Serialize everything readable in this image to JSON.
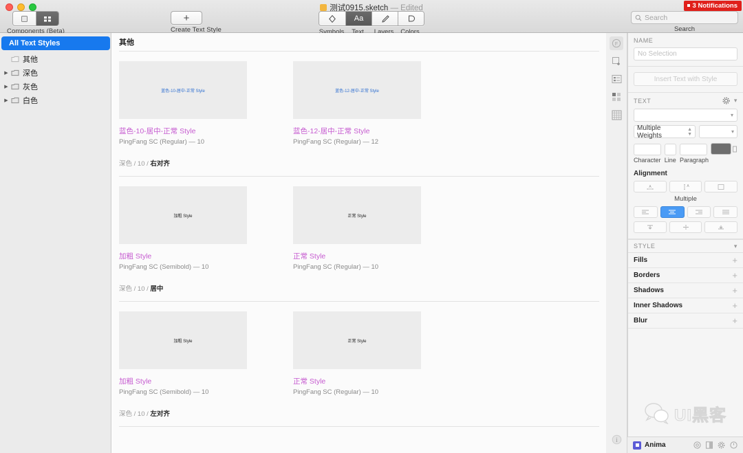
{
  "window": {
    "document_title": "测试0915.sketch",
    "document_state": "— Edited"
  },
  "toolbar": {
    "components_label": "Components (Beta)",
    "create_text_style_label": "Create Text Style",
    "create_text_style_glyph": "+",
    "view_buttons": [
      {
        "label": "Symbols",
        "icon": "diamond-icon",
        "active": false
      },
      {
        "label": "Text",
        "icon": "text-aa-icon",
        "active": true
      },
      {
        "label": "Layers",
        "icon": "layers-brush-icon",
        "active": false
      },
      {
        "label": "Colors",
        "icon": "colors-palette-icon",
        "active": false
      }
    ],
    "text_glyph": "Aa",
    "notifications": "3 Notifications",
    "search_placeholder": "Search",
    "search_label": "Search",
    "search_value": ""
  },
  "sidebar": {
    "items": [
      {
        "label": "All Text Styles",
        "selected": true,
        "has_disclosure": false,
        "icon": "none"
      },
      {
        "label": "其他",
        "selected": false,
        "has_disclosure": false,
        "icon": "folder-icon"
      },
      {
        "label": "深色",
        "selected": false,
        "has_disclosure": true,
        "icon": "folder-icon"
      },
      {
        "label": "灰色",
        "selected": false,
        "has_disclosure": true,
        "icon": "folder-icon"
      },
      {
        "label": "白色",
        "selected": false,
        "has_disclosure": true,
        "icon": "folder-icon"
      }
    ]
  },
  "canvas": {
    "group_title": "其他",
    "rows": [
      {
        "breadcrumb_prefix": "深色 / 10 / ",
        "breadcrumb_bold": "右对齐",
        "cards": [
          {
            "preview_text": "蓝色-10-居中-正常 Style",
            "preview_color": "blue",
            "name": "蓝色-10-居中-正常 Style",
            "meta": "PingFang SC (Regular) — 10"
          },
          {
            "preview_text": "蓝色-12-居中-正常 Style",
            "preview_color": "blue",
            "name": "蓝色-12-居中-正常 Style",
            "meta": "PingFang SC (Regular) — 12"
          }
        ]
      },
      {
        "breadcrumb_prefix": "深色 / 10 / ",
        "breadcrumb_bold": "居中",
        "cards": [
          {
            "preview_text": "加粗 Style",
            "preview_color": "dark",
            "name": "加粗 Style",
            "meta": "PingFang SC (Semibold) — 10"
          },
          {
            "preview_text": "正常 Style",
            "preview_color": "dark",
            "name": "正常 Style",
            "meta": "PingFang SC (Regular) — 10"
          }
        ]
      },
      {
        "breadcrumb_prefix": "深色 / 10 / ",
        "breadcrumb_bold": "左对齐",
        "cards": [
          {
            "preview_text": "加粗 Style",
            "preview_color": "dark",
            "name": "加粗 Style",
            "meta": "PingFang SC (Semibold) — 10"
          },
          {
            "preview_text": "正常 Style",
            "preview_color": "dark",
            "name": "正常 Style",
            "meta": "PingFang SC (Regular) — 10"
          }
        ]
      }
    ]
  },
  "icon_strip": {
    "buttons": [
      "preferences-f-icon",
      "insert-artboard-icon",
      "list-view-icon",
      "grid-view-icon",
      "table-grid-icon"
    ],
    "bottom_button": "info-icon"
  },
  "inspector": {
    "name_section_label": "NAME",
    "name_value": "",
    "name_placeholder": "No Selection",
    "insert_button_label": "Insert Text with Style",
    "text_section_label": "TEXT",
    "font_family_value": "",
    "weight_value": "Multiple Weights",
    "size_value": "",
    "spacing_fields": [
      {
        "label": "Character",
        "value": ""
      },
      {
        "label": "Line",
        "value": ""
      },
      {
        "label": "Paragraph",
        "value": ""
      }
    ],
    "color_swatch": "#6e6e6e",
    "alignment_label": "Alignment",
    "multiple_note": "Multiple",
    "horizontal_alignment": [
      {
        "icon": "align-left-icon",
        "active": false
      },
      {
        "icon": "align-center-icon",
        "active": true
      },
      {
        "icon": "align-right-icon",
        "active": false
      },
      {
        "icon": "align-justify-icon",
        "active": false
      }
    ],
    "vertical_alignment": [
      {
        "icon": "align-top-icon",
        "active": false
      },
      {
        "icon": "align-middle-icon",
        "active": false
      },
      {
        "icon": "align-bottom-icon",
        "active": false
      }
    ],
    "transform_buttons": [
      "text-transform-icon",
      "text-decoration-icon",
      "text-fit-icon"
    ],
    "style_section_label": "STYLE",
    "style_rows": [
      {
        "label": "Fills",
        "add": "+"
      },
      {
        "label": "Borders",
        "add": "+"
      },
      {
        "label": "Shadows",
        "add": "+"
      },
      {
        "label": "Inner Shadows",
        "add": "+"
      },
      {
        "label": "Blur",
        "add": "+"
      }
    ]
  },
  "watermark": {
    "text": "UI黑客",
    "icon": "wechat-icon"
  },
  "plugin_bar": {
    "name": "Anima",
    "icons": [
      "target-icon",
      "panel-icon",
      "gear-icon",
      "power-icon"
    ]
  },
  "colors": {
    "accent_selection": "#1779ee",
    "style_name": "#c65bd0",
    "preview_blue": "#2f6fd0",
    "notification_red": "#e0201b",
    "alignment_active": "#4a9bf5"
  }
}
